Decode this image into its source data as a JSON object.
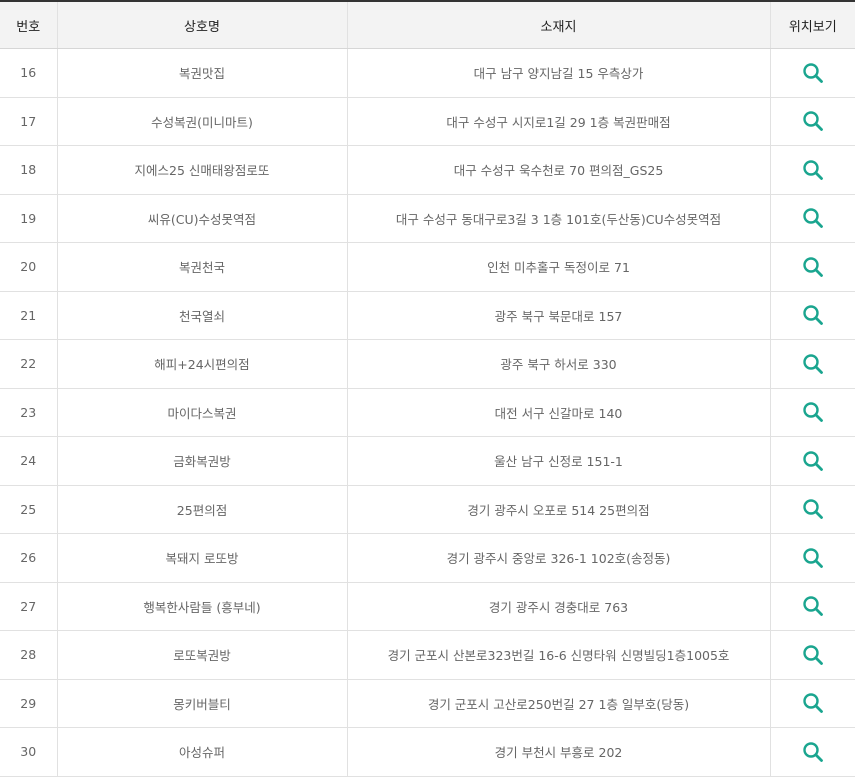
{
  "table": {
    "headers": {
      "no": "번호",
      "name": "상호명",
      "address": "소재지",
      "location": "위치보기"
    },
    "rows": [
      {
        "no": "16",
        "name": "복권맛집",
        "address": "대구 남구 양지남길 15 우측상가"
      },
      {
        "no": "17",
        "name": "수성복권(미니마트)",
        "address": "대구 수성구 시지로1길 29 1층 복권판매점"
      },
      {
        "no": "18",
        "name": "지에스25 신매태왕점로또",
        "address": "대구 수성구 욱수천로 70 편의점_GS25"
      },
      {
        "no": "19",
        "name": "씨유(CU)수성못역점",
        "address": "대구 수성구 동대구로3길 3 1층 101호(두산동)CU수성못역점"
      },
      {
        "no": "20",
        "name": "복권천국",
        "address": "인천 미추홀구 독정이로 71"
      },
      {
        "no": "21",
        "name": "천국열쇠",
        "address": "광주 북구 북문대로 157"
      },
      {
        "no": "22",
        "name": "해피+24시편의점",
        "address": "광주 북구 하서로 330"
      },
      {
        "no": "23",
        "name": "마이다스복권",
        "address": "대전 서구 신갈마로 140"
      },
      {
        "no": "24",
        "name": "금화복권방",
        "address": "울산 남구 신정로 151-1"
      },
      {
        "no": "25",
        "name": "25편의점",
        "address": "경기 광주시 오포로 514 25편의점"
      },
      {
        "no": "26",
        "name": "복돼지 로또방",
        "address": "경기 광주시 중앙로 326-1 102호(송정동)"
      },
      {
        "no": "27",
        "name": "행복한사람들 (흥부네)",
        "address": "경기 광주시 경충대로 763"
      },
      {
        "no": "28",
        "name": "로또복권방",
        "address": "경기 군포시 산본로323번길 16-6 신명타워 신명빌딩1층1005호"
      },
      {
        "no": "29",
        "name": "몽키버블티",
        "address": "경기 군포시 고산로250번길 27 1층 일부호(당동)"
      },
      {
        "no": "30",
        "name": "아성슈퍼",
        "address": "경기 부천시 부흥로 202"
      }
    ]
  },
  "icons": {
    "location_button": "search-icon"
  },
  "colors": {
    "search_icon": "#1aa58f",
    "header_bg": "#f3f3f3",
    "top_border": "#333333",
    "cell_text": "#666666"
  }
}
